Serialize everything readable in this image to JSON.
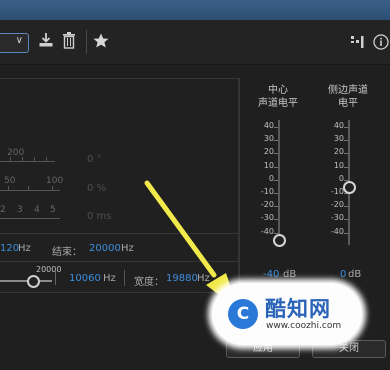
{
  "toolbar": {
    "preset_arrow": "∨",
    "icons": [
      "save-preset-icon",
      "delete-preset-icon",
      "favorite-icon",
      "routing-icon",
      "info-icon"
    ]
  },
  "ruler": {
    "angle_labels": [
      "200"
    ],
    "pct_labels": [
      "50",
      "100"
    ],
    "ms_labels": [
      "2",
      "3",
      "4",
      "5"
    ],
    "values": [
      "0 °",
      "0 %",
      "0 ms"
    ]
  },
  "freq": {
    "start_value": "120",
    "unit": "Hz",
    "end_label": "结束：",
    "end_value": "20000",
    "slider_max_label": "20000",
    "center_value": "10060",
    "width_label": "宽度：",
    "width_value": "19880"
  },
  "levels": {
    "center_title_1": "中心",
    "center_title_2": "声道电平",
    "side_title_1": "侧边声道",
    "side_title_2": "电平",
    "scale": [
      "40",
      "30",
      "20",
      "10",
      "0",
      "-10",
      "-20",
      "-30",
      "-40"
    ],
    "center_value": "-40",
    "side_value": "0",
    "unit": "dB"
  },
  "buttons": {
    "apply": "应用",
    "close": "关闭"
  },
  "watermark": {
    "logo_letter": "C",
    "title": "酷知网",
    "url": "www.coozhi.com"
  },
  "colors": {
    "accent_blue": "#3c8dde",
    "arrow_yellow": "#f2ea4a"
  }
}
